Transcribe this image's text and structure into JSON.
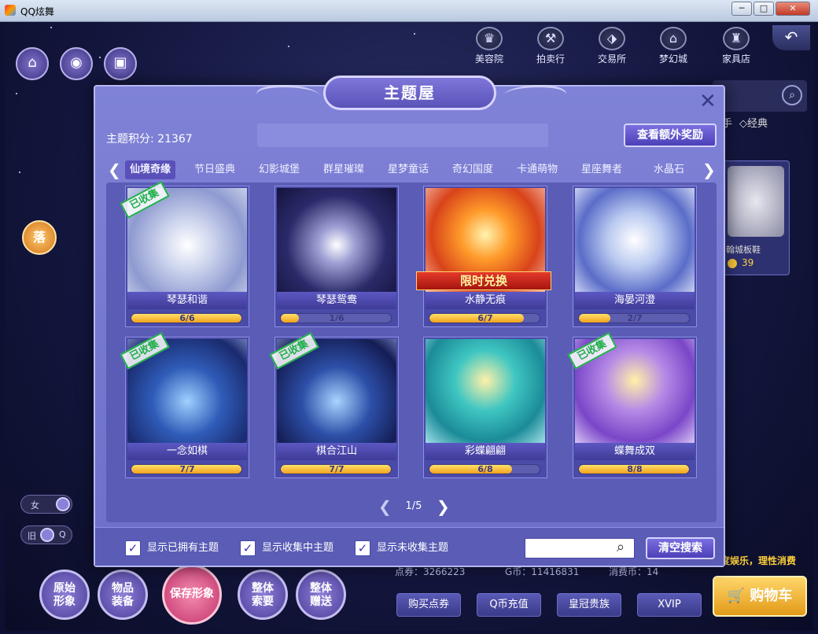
{
  "window": {
    "title": "QQ炫舞",
    "min": "─",
    "max": "□",
    "close": "✕"
  },
  "topnav": [
    {
      "label": "美容院",
      "icon": "beauty-salon-icon",
      "glyph": "♛"
    },
    {
      "label": "拍卖行",
      "icon": "auction-icon",
      "glyph": "⚒"
    },
    {
      "label": "交易所",
      "icon": "exchange-icon",
      "glyph": "⬗"
    },
    {
      "label": "梦幻城",
      "icon": "dream-city-icon",
      "glyph": "⌂"
    },
    {
      "label": "家具店",
      "icon": "furniture-icon",
      "glyph": "♜"
    }
  ],
  "back_glyph": "↶",
  "left_icons": {
    "home": "⌂",
    "pill": "◉",
    "gift": "▣"
  },
  "drop_label": "落",
  "gender_toggle": {
    "label": "女"
  },
  "old_toggle": {
    "left": "旧",
    "right": "Q"
  },
  "bottom_round": [
    {
      "line1": "原始",
      "line2": "形象"
    },
    {
      "line1": "物品",
      "line2": "装备"
    },
    {
      "line1": "保存形象",
      "line2": ""
    },
    {
      "line1": "整体",
      "line2": "索要"
    },
    {
      "line1": "整体",
      "line2": "赠送"
    }
  ],
  "background_right": {
    "tab_text": "手",
    "classic": "◇经典",
    "item_name": "翰城板鞋",
    "item_price": "39",
    "slogan": "度娱乐，理性消费",
    "points": "点券：3266223",
    "gcoin": "G币：11416831",
    "consume": "消费币：14",
    "cart": "购物车"
  },
  "bottom_buttons": [
    "购买点券",
    "Q币充值",
    "皇冠贵族",
    "XVIP"
  ],
  "modal": {
    "title": "主题屋",
    "close": "✕",
    "score_label": "主题积分: 21367",
    "reward_button": "查看额外奖励",
    "tab_prev": "❮",
    "tab_next": "❯",
    "tabs": [
      "仙境奇缘",
      "节日盛典",
      "幻影城堡",
      "群星璀璨",
      "星梦童话",
      "奇幻国度",
      "卡通萌物",
      "星座舞者",
      "水晶石"
    ],
    "active_tab": 0,
    "collected_badge": "已收集",
    "limited_label": "限时兑换",
    "cards": [
      {
        "name": "琴瑟和谐",
        "have": 6,
        "total": 6,
        "progress": "6/6",
        "collected": true,
        "limited": false,
        "theme": "white-lotus"
      },
      {
        "name": "琴瑟鸳鸯",
        "have": 1,
        "total": 6,
        "progress": "1/6",
        "collected": false,
        "limited": false,
        "theme": "dark-lotus"
      },
      {
        "name": "水静无痕",
        "have": 6,
        "total": 7,
        "progress": "6/7",
        "collected": false,
        "limited": true,
        "theme": "fire-koi"
      },
      {
        "name": "海晏河澄",
        "have": 2,
        "total": 7,
        "progress": "2/7",
        "collected": false,
        "limited": false,
        "theme": "ice-koi"
      },
      {
        "name": "一念如棋",
        "have": 7,
        "total": 7,
        "progress": "7/7",
        "collected": true,
        "limited": false,
        "theme": "go-board-light"
      },
      {
        "name": "棋合江山",
        "have": 7,
        "total": 7,
        "progress": "7/7",
        "collected": true,
        "limited": false,
        "theme": "go-board-dark"
      },
      {
        "name": "彩蝶翩翩",
        "have": 6,
        "total": 8,
        "progress": "6/8",
        "collected": false,
        "limited": false,
        "theme": "butterfly-teal"
      },
      {
        "name": "蝶舞成双",
        "have": 8,
        "total": 8,
        "progress": "8/8",
        "collected": true,
        "limited": false,
        "theme": "butterfly-purple"
      }
    ],
    "pager": {
      "prev": "❮",
      "text": "1/5",
      "next": "❯"
    },
    "filters": [
      {
        "label": "显示已拥有主题",
        "checked": true
      },
      {
        "label": "显示收集中主题",
        "checked": true
      },
      {
        "label": "显示未收集主题",
        "checked": true
      }
    ],
    "search_value": "",
    "search_icon": "⌕",
    "clear_button": "清空搜索"
  }
}
